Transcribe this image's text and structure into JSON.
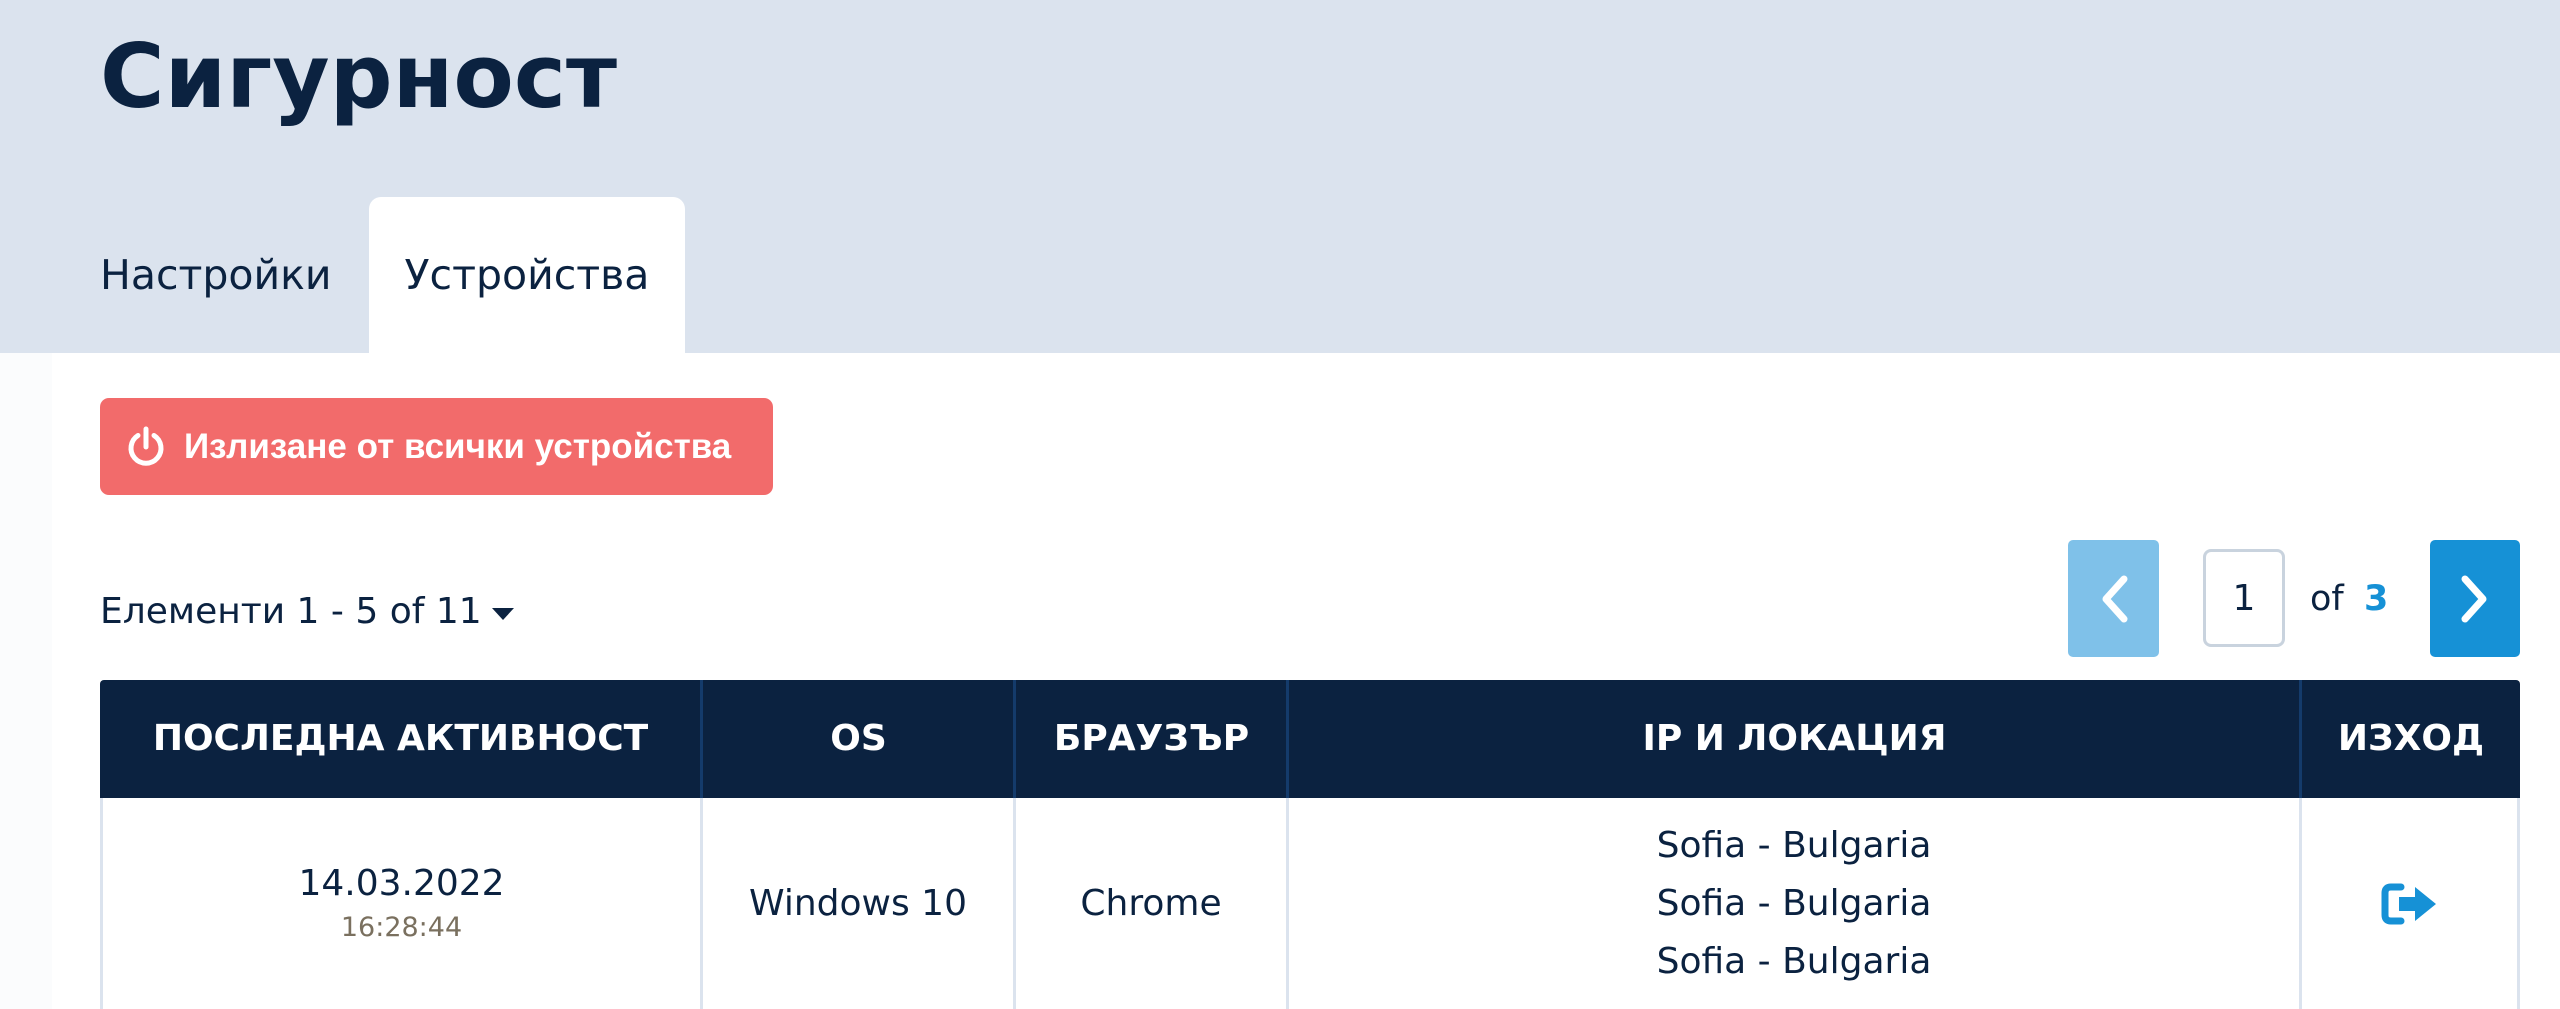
{
  "page": {
    "title": "Сигурност"
  },
  "tabs": [
    {
      "label": "Настройки",
      "active": false
    },
    {
      "label": "Устройства",
      "active": true
    }
  ],
  "actions": {
    "logout_all_label": "Излизане от всички устройства"
  },
  "list_info": {
    "label": "Елементи 1 - 5 of 11"
  },
  "pagination": {
    "current": "1",
    "of_label": "of",
    "total": "3"
  },
  "table": {
    "headers": [
      "ПОСЛЕДНА АКТИВНОСТ",
      "OS",
      "БРАУЗЪР",
      "IP И ЛОКАЦИЯ",
      "ИЗХОД"
    ],
    "rows": [
      {
        "date": "14.03.2022",
        "time": "16:28:44",
        "os": "Windows 10",
        "browser": "Chrome",
        "locations": [
          "Sofia - Bulgaria",
          "Sofia - Bulgaria",
          "Sofia - Bulgaria"
        ]
      }
    ]
  },
  "colors": {
    "header_bg": "#dbe3ee",
    "navy": "#0b2240",
    "danger": "#f26b6b",
    "primary": "#1691d6",
    "primary_light": "#7fc1e9"
  },
  "icons": {
    "logout_all": "power-icon",
    "prev": "chevron-left-icon",
    "next": "chevron-right-icon",
    "items_dropdown": "caret-down-icon",
    "row_logout": "sign-out-icon"
  }
}
